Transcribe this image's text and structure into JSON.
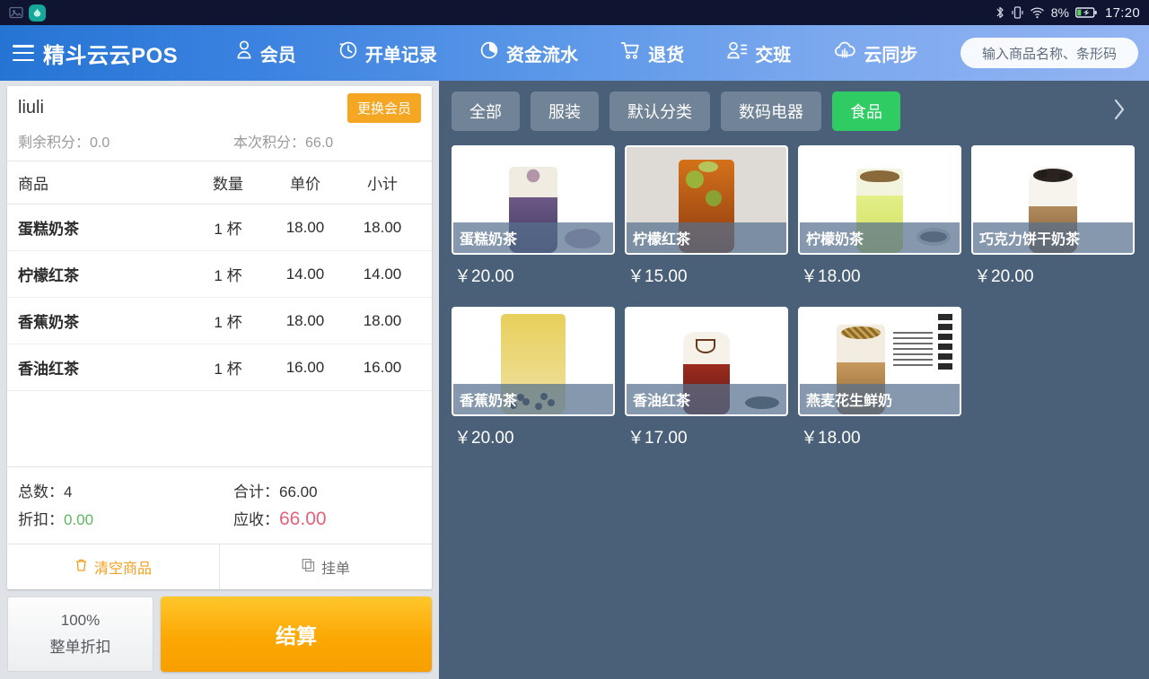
{
  "statusbar": {
    "left_icons": [
      "screenshot-icon",
      "app-icon"
    ],
    "right_icons": [
      "bluetooth-icon",
      "vibrate-icon",
      "wifi-icon"
    ],
    "battery_percent": "8%",
    "time": "17:20"
  },
  "header": {
    "brand": "精斗云云POS",
    "nav": [
      {
        "label": "会员",
        "icon": "member-icon"
      },
      {
        "label": "开单记录",
        "icon": "order-history-icon"
      },
      {
        "label": "资金流水",
        "icon": "cashflow-icon"
      },
      {
        "label": "退货",
        "icon": "return-cart-icon"
      },
      {
        "label": "交班",
        "icon": "shift-handover-icon"
      },
      {
        "label": "云同步",
        "icon": "cloud-sync-icon"
      }
    ],
    "search_placeholder": "输入商品名称、条形码"
  },
  "cart": {
    "member_name": "liuli",
    "change_member_label": "更换会员",
    "points_left_label": "剩余积分：",
    "points_left_value": "0.0",
    "points_this_label": "本次积分：",
    "points_this_value": "66.0",
    "columns": {
      "name": "商品",
      "qty": "数量",
      "price": "单价",
      "subtotal": "小计"
    },
    "items": [
      {
        "name": "蛋糕奶茶",
        "qty": "1 杯",
        "price": "18.00",
        "subtotal": "18.00"
      },
      {
        "name": "柠檬红茶",
        "qty": "1 杯",
        "price": "14.00",
        "subtotal": "14.00"
      },
      {
        "name": "香蕉奶茶",
        "qty": "1 杯",
        "price": "18.00",
        "subtotal": "18.00"
      },
      {
        "name": "香油红茶",
        "qty": "1 杯",
        "price": "16.00",
        "subtotal": "16.00"
      }
    ],
    "totals": {
      "count_label": "总数：",
      "count_value": "4",
      "sum_label": "合计：",
      "sum_value": "66.00",
      "discount_label": "折扣：",
      "discount_value": "0.00",
      "due_label": "应收：",
      "due_value": "66.00"
    },
    "clear_label": "清空商品",
    "hold_label": "挂单",
    "discount_percent": "100%",
    "discount_caption": "整单折扣",
    "settle_label": "结算"
  },
  "categories": [
    {
      "label": "全部",
      "active": false
    },
    {
      "label": "服装",
      "active": false
    },
    {
      "label": "默认分类",
      "active": false
    },
    {
      "label": "数码电器",
      "active": false
    },
    {
      "label": "食品",
      "active": true
    }
  ],
  "products": [
    {
      "name": "蛋糕奶茶",
      "price": "￥20.00"
    },
    {
      "name": "柠檬红茶",
      "price": "￥15.00"
    },
    {
      "name": "柠檬奶茶",
      "price": "￥18.00"
    },
    {
      "name": "巧克力饼干奶茶",
      "price": "￥20.00"
    },
    {
      "name": "香蕉奶茶",
      "price": "￥20.00"
    },
    {
      "name": "香油红茶",
      "price": "￥17.00"
    },
    {
      "name": "燕麦花生鲜奶",
      "price": "￥18.00"
    }
  ],
  "colors": {
    "accent_orange": "#f5a623",
    "settle_orange": "#fca804",
    "active_green": "#2ecc62",
    "panel_bg": "#4a6079",
    "due_red": "#e8607b",
    "discount_green": "#5cb85c"
  }
}
